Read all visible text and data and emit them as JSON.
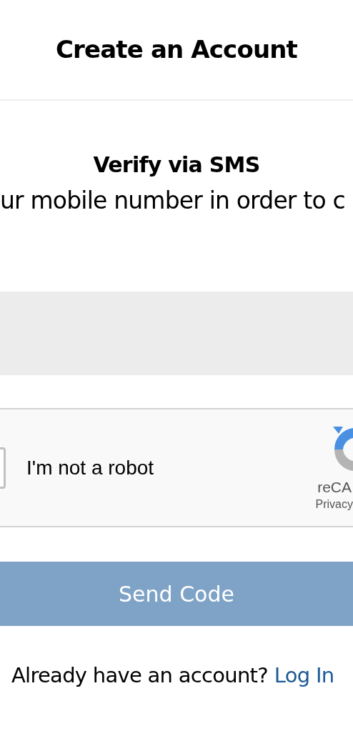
{
  "header": {
    "title": "Create an Account"
  },
  "section": {
    "title": "Verify via SMS",
    "description": "ur mobile number in order to c"
  },
  "captcha": {
    "checked": false,
    "label": "I'm not a robot",
    "brand": "reCA",
    "links": "Privacy"
  },
  "send_button": {
    "label": "Send Code",
    "disabled": true
  },
  "footer": {
    "text": "Already have an account?",
    "link": "Log In"
  }
}
